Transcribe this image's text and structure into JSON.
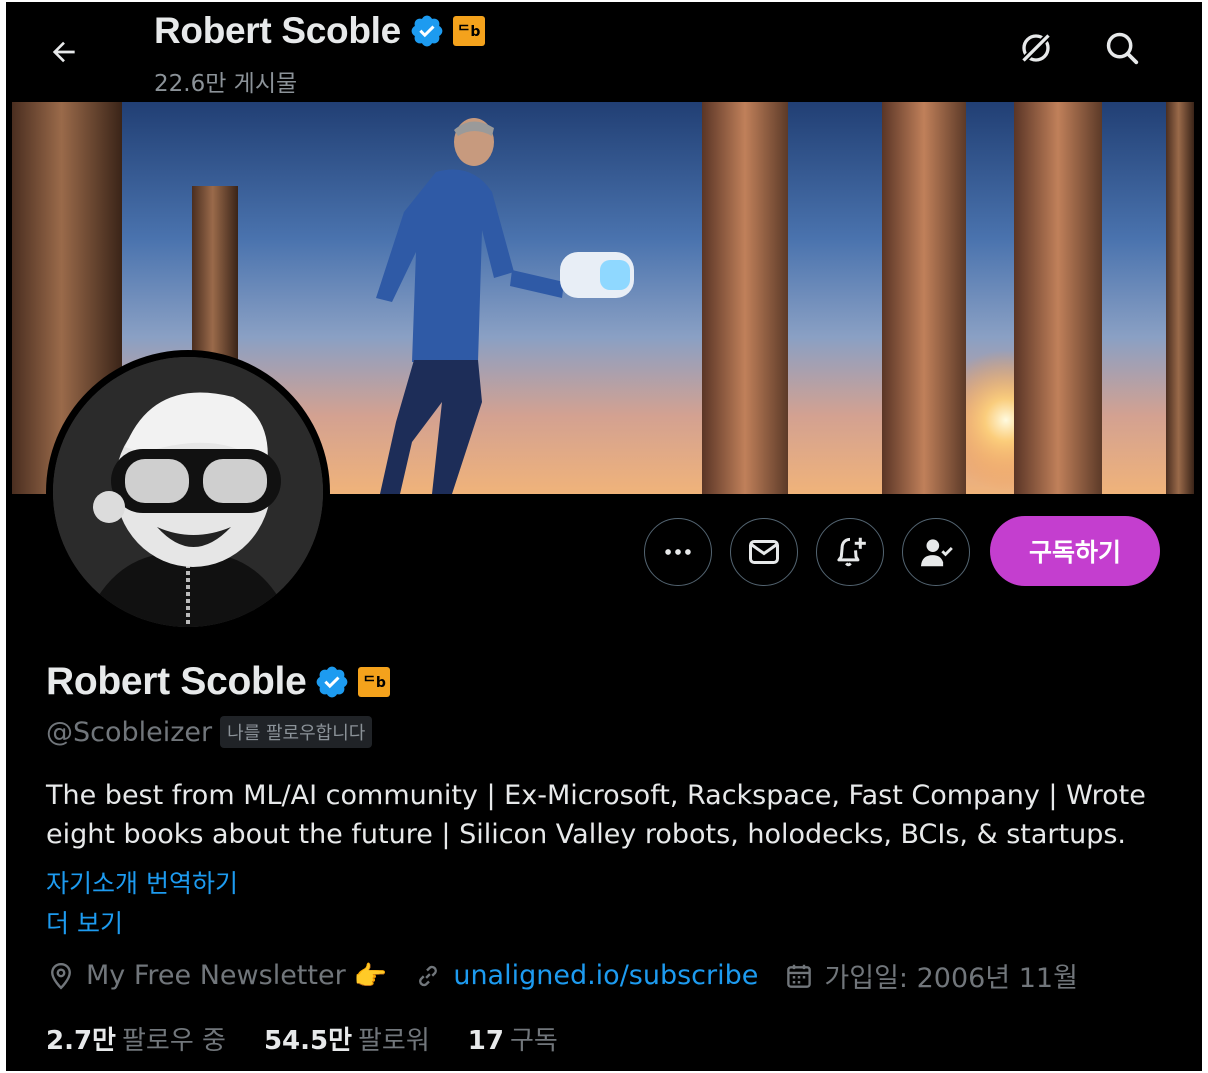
{
  "header": {
    "name": "Robert Scoble",
    "post_count": "22.6만 게시물",
    "icons": [
      "back-arrow-icon",
      "grok-icon",
      "search-icon"
    ]
  },
  "profile": {
    "name": "Robert Scoble",
    "handle": "@Scobleizer",
    "follows_you": "나를 팔로우합니다",
    "affiliate_badge": "ᄃb",
    "bio_line1": "The best from ML/AI community | Ex-Microsoft, Rackspace, Fast Company | Wrote",
    "bio_line2": "eight books about the future | Silicon Valley robots, holodecks, BCIs, & startups.",
    "translate_bio": "자기소개 번역하기",
    "show_more": "더 보기",
    "location": "My Free Newsletter",
    "location_emoji": "👉",
    "website": "unaligned.io/subscribe",
    "joined": "가입일: 2006년 11월"
  },
  "actions": {
    "more": "more-icon",
    "message": "mail-icon",
    "notify": "bell-plus-icon",
    "following": "person-check-icon",
    "subscribe_label": "구독하기"
  },
  "stats": {
    "following_count": "2.7만",
    "following_label": "팔로우 중",
    "followers_count": "54.5만",
    "followers_label": "팔로워",
    "subscriptions_count": "17",
    "subscriptions_label": "구독"
  },
  "colors": {
    "background": "#000000",
    "accent_blue": "#1d9bf0",
    "subscribe_purple": "#c43ecf",
    "verified_blue": "#1d9bf0",
    "affiliate_gold": "#f4a21c",
    "muted_text": "#71767b"
  }
}
